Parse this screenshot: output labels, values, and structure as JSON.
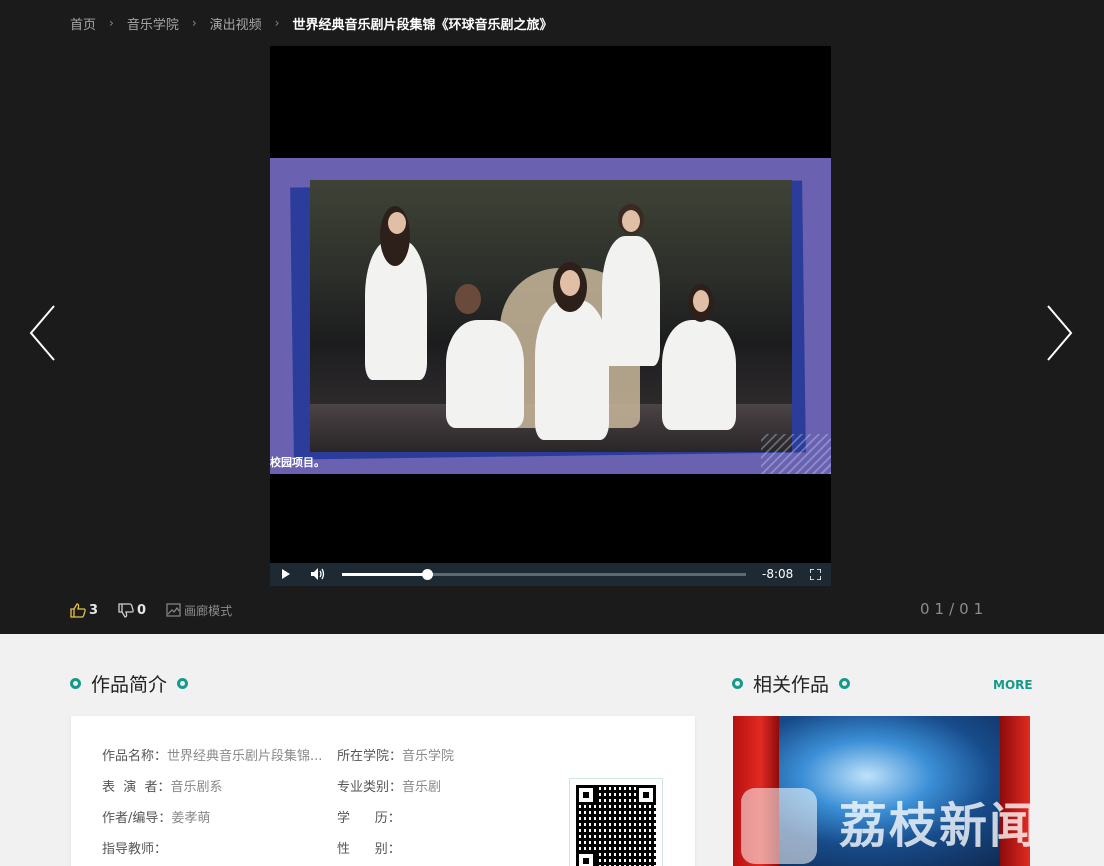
{
  "breadcrumb": [
    "首页",
    "音乐学院",
    "演出视频",
    "世界经典音乐剧片段集锦《环球音乐剧之旅》"
  ],
  "video": {
    "caption": "校园项目。",
    "time_remaining": "-8:08",
    "progress": 0.21
  },
  "actions": {
    "likes": "3",
    "dislikes": "0",
    "gallery_label": "画廊模式"
  },
  "pager": "01/01",
  "intro": {
    "title": "作品简介",
    "fields": [
      {
        "key": "作品名称：",
        "value": "世界经典音乐剧片段集锦..."
      },
      {
        "key": "所在学院：",
        "value": "音乐学院"
      },
      {
        "key": "表  演  者：",
        "value": "音乐剧系"
      },
      {
        "key": "专业类别：",
        "value": "音乐剧"
      },
      {
        "key": "作者/编导：",
        "value": "姜孝萌"
      },
      {
        "key": "学      历：",
        "value": ""
      },
      {
        "key": "指导教师：",
        "value": ""
      },
      {
        "key": "性      别：",
        "value": ""
      }
    ]
  },
  "related": {
    "title": "相关作品",
    "more": "MORE",
    "watermark": "荔枝新闻"
  },
  "colors": {
    "accent": "#169a8c",
    "dark_bg": "#1b1b1b",
    "like": "#e8c34a"
  }
}
